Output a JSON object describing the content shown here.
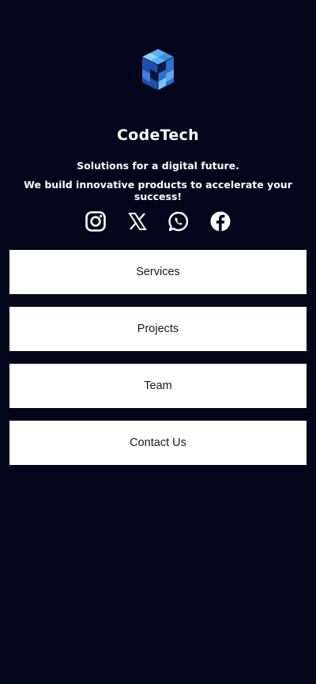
{
  "profile": {
    "brand_name": "CodeTech",
    "tagline_line1": "Solutions for a digital future.",
    "tagline_line2": "We build innovative products to accelerate your success!",
    "logo_icon": "isometric-cube-logo-icon"
  },
  "socials": [
    {
      "icon": "instagram-icon"
    },
    {
      "icon": "x-twitter-icon"
    },
    {
      "icon": "whatsapp-icon"
    },
    {
      "icon": "facebook-icon"
    }
  ],
  "links": [
    {
      "label": "Services"
    },
    {
      "label": "Projects"
    },
    {
      "label": "Team"
    },
    {
      "label": "Contact Us"
    }
  ],
  "colors": {
    "background": "#03051a",
    "button_background": "#ffffff",
    "button_text": "#1a1a1a",
    "text": "#ffffff",
    "logo_accent": "#3a8ee6"
  }
}
